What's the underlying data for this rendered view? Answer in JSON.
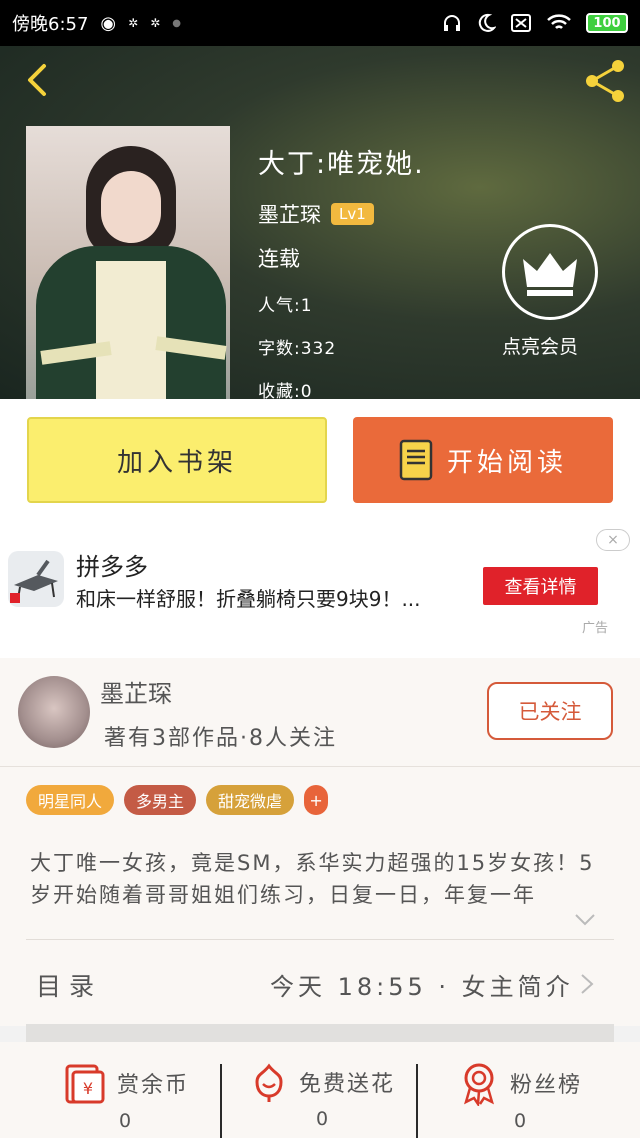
{
  "status_bar": {
    "time": "傍晚6:57",
    "battery": "100"
  },
  "book": {
    "title": "大丁:唯宠她.",
    "author": "墨芷琛",
    "level": "Lv1",
    "status": "连载",
    "popularity": "人气:1",
    "word_count": "字数:332",
    "favorites": "收藏:0",
    "vip_label": "点亮会员"
  },
  "actions": {
    "add_shelf": "加入书架",
    "start_reading": "开始阅读"
  },
  "ad": {
    "brand": "拼多多",
    "text": "和床一样舒服！折叠躺椅只要9块9！...",
    "cta": "查看详情",
    "close": "×",
    "tag": "广告"
  },
  "author_card": {
    "name": "墨芷琛",
    "meta": "著有3部作品·8人关注",
    "follow": "已关注"
  },
  "tags": [
    {
      "label": "明星同人",
      "color": "#f1a93c"
    },
    {
      "label": "多男主",
      "color": "#c45b45"
    },
    {
      "label": "甜宠微虐",
      "color": "#d6a13a"
    },
    {
      "label": "+",
      "color": "#e8643a"
    }
  ],
  "intro": "大丁唯一女孩，竟是SM，系华实力超强的15岁女孩！5岁开始随着哥哥姐姐们练习，日复一日，年复一年",
  "toc": {
    "label": "目录",
    "info": "今天 18:55 · 女主简介"
  },
  "rewards": [
    {
      "label": "赏余币",
      "count": "0",
      "icon": "red-envelope-icon"
    },
    {
      "label": "免费送花",
      "count": "0",
      "icon": "flower-icon"
    },
    {
      "label": "粉丝榜",
      "count": "0",
      "icon": "medal-icon"
    }
  ],
  "colors": {
    "accent_orange": "#ea6a3a",
    "shelf_yellow": "#fbee6e",
    "ad_red": "#e0222a"
  }
}
